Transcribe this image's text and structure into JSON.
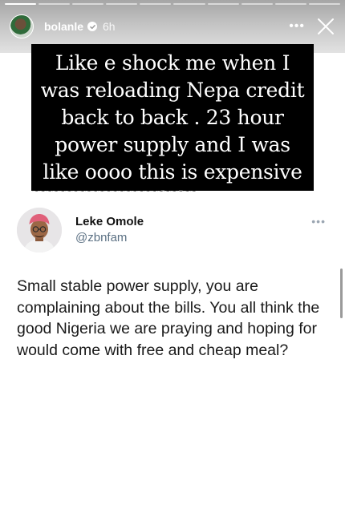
{
  "story": {
    "username": "bolanle",
    "time": "6h",
    "more_label": "•••",
    "progress_segments": 10,
    "progress_done": 1,
    "caption": "Like e shock me when I was reloading Nepa credit back to back . 23 hour power supply and I was like oooo this is expensive lol",
    "icons": [
      "verified-badge-icon",
      "more-options-icon",
      "close-icon"
    ]
  },
  "tweet": {
    "display_name": "Leke Omole",
    "handle": "@zbnfam",
    "more_label": "•••",
    "text": "Small stable power supply, you are complaining about the bills. You all think the good Nigeria we are praying and hoping for would come with free and cheap meal?"
  },
  "colors": {
    "caption_bg": "#000000",
    "caption_text": "#ffffff",
    "handle": "#5b7083"
  }
}
